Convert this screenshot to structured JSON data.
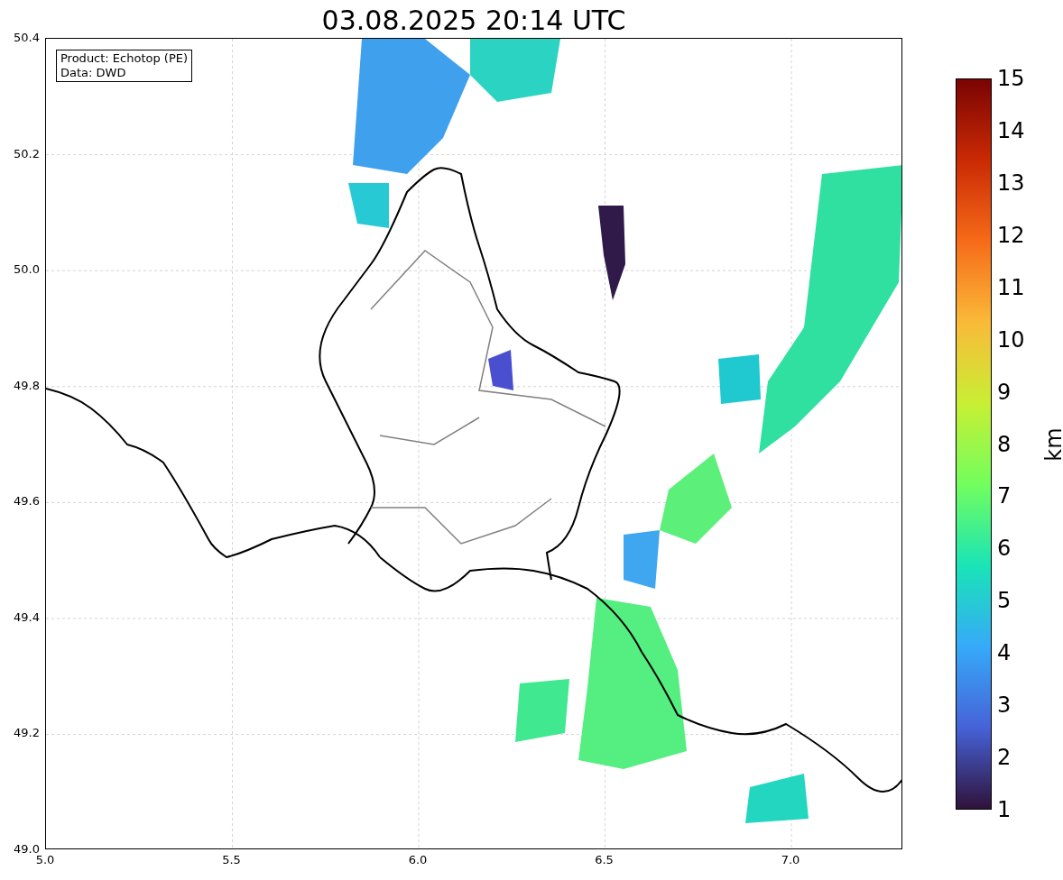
{
  "title": "03.08.2025 20:14 UTC",
  "info_box": {
    "lines": [
      "Product: Echotop (PE)",
      "Data: DWD"
    ]
  },
  "x_axis": {
    "ticks": [
      "5.0",
      "5.5",
      "6.0",
      "6.5",
      "7.0"
    ]
  },
  "y_axis": {
    "ticks": [
      "50.4",
      "50.2",
      "50.0",
      "49.8",
      "49.6",
      "49.4",
      "49.2",
      "49.0"
    ]
  },
  "colorbar": {
    "label": "km",
    "ticks": [
      "15",
      "14",
      "13",
      "12",
      "11",
      "10",
      "9",
      "8",
      "7",
      "6",
      "5",
      "4",
      "3",
      "2",
      "1"
    ]
  }
}
